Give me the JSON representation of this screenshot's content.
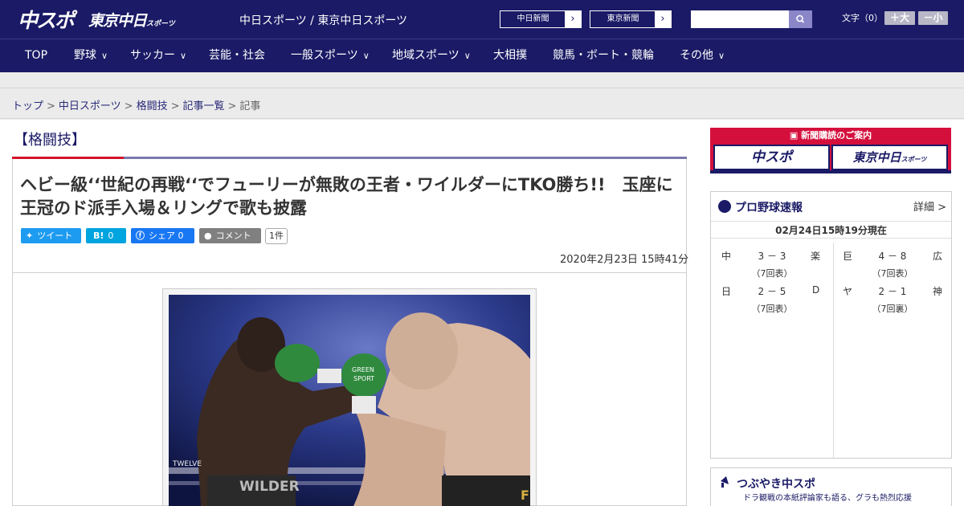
{
  "header": {
    "logo_chuspo": "中スポ",
    "logo_tokyo": "東京中日",
    "logo_tokyo_small": "スポーツ",
    "site_title": "中日スポーツ / 東京中日スポーツ",
    "btn_chunichi": "中日新聞",
    "btn_tokyo": "東京新聞",
    "search_placeholder": "",
    "fontsize_label": "文字（0）",
    "font_bigger": "＋大",
    "font_smaller": "－小"
  },
  "nav": [
    {
      "label": "TOP",
      "has_menu": false
    },
    {
      "label": "野球",
      "has_menu": true
    },
    {
      "label": "サッカー",
      "has_menu": true
    },
    {
      "label": "芸能・社会",
      "has_menu": false
    },
    {
      "label": "一般スポーツ",
      "has_menu": true
    },
    {
      "label": "地域スポーツ",
      "has_menu": true
    },
    {
      "label": "大相撲",
      "has_menu": false
    },
    {
      "label": "競馬・ボート・競輪",
      "has_menu": false
    },
    {
      "label": "その他",
      "has_menu": true
    }
  ],
  "breadcrumb": [
    "トップ",
    "中日スポーツ",
    "格闘技",
    "記事一覧",
    "記事"
  ],
  "article": {
    "category": "【格闘技】",
    "headline": "ヘビー級‘‘世紀の再戦‘‘でフューリーが無敗の王者・ワイルダーにTKO勝ち!!　玉座に王冠のド派手入場＆リングで歌も披露",
    "tweet": "ツイート",
    "hatena_icon": "B!",
    "hatena_count": "0",
    "share_label": "シェア",
    "share_count": "0",
    "comment_label": "コメント",
    "comment_count": "1件",
    "date": "2020年2月23日 15時41分",
    "photo_text_1": "GREEN",
    "photo_text_2": "SPORT",
    "photo_text_3": "TWELVE",
    "photo_text_4": "WILDER",
    "photo_text_5": "F"
  },
  "sidebar": {
    "ad_title": "新聞購読のご案内",
    "ad_chuspo": "中スポ",
    "ad_tokyo": "東京中日",
    "ad_tokyo_small": "スポーツ",
    "baseball_title": "プロ野球速報",
    "baseball_more": "詳細 >",
    "baseball_time": "02月24日15時19分現在",
    "games": [
      {
        "home": "中",
        "score": "3 － 3",
        "away": "楽",
        "inning": "（7回表）"
      },
      {
        "home": "巨",
        "score": "4 － 8",
        "away": "広",
        "inning": "（7回表）"
      },
      {
        "home": "日",
        "score": "2 － 5",
        "away": "D",
        "inning": "（7回表）"
      },
      {
        "home": "ヤ",
        "score": "2 － 1",
        "away": "神",
        "inning": "（7回裏）"
      }
    ],
    "tsubuyaki_title": "つぶやき中スポ",
    "tsubuyaki_sub": "ドラ観戦の本紙評論家も語る、グラも熱烈応援"
  },
  "colors": {
    "brand_navy": "#1a1a66",
    "accent_red": "#d4142b",
    "twitter": "#1d9bf0",
    "hatena": "#00a4de",
    "facebook": "#1877f2",
    "comment": "#808080"
  }
}
